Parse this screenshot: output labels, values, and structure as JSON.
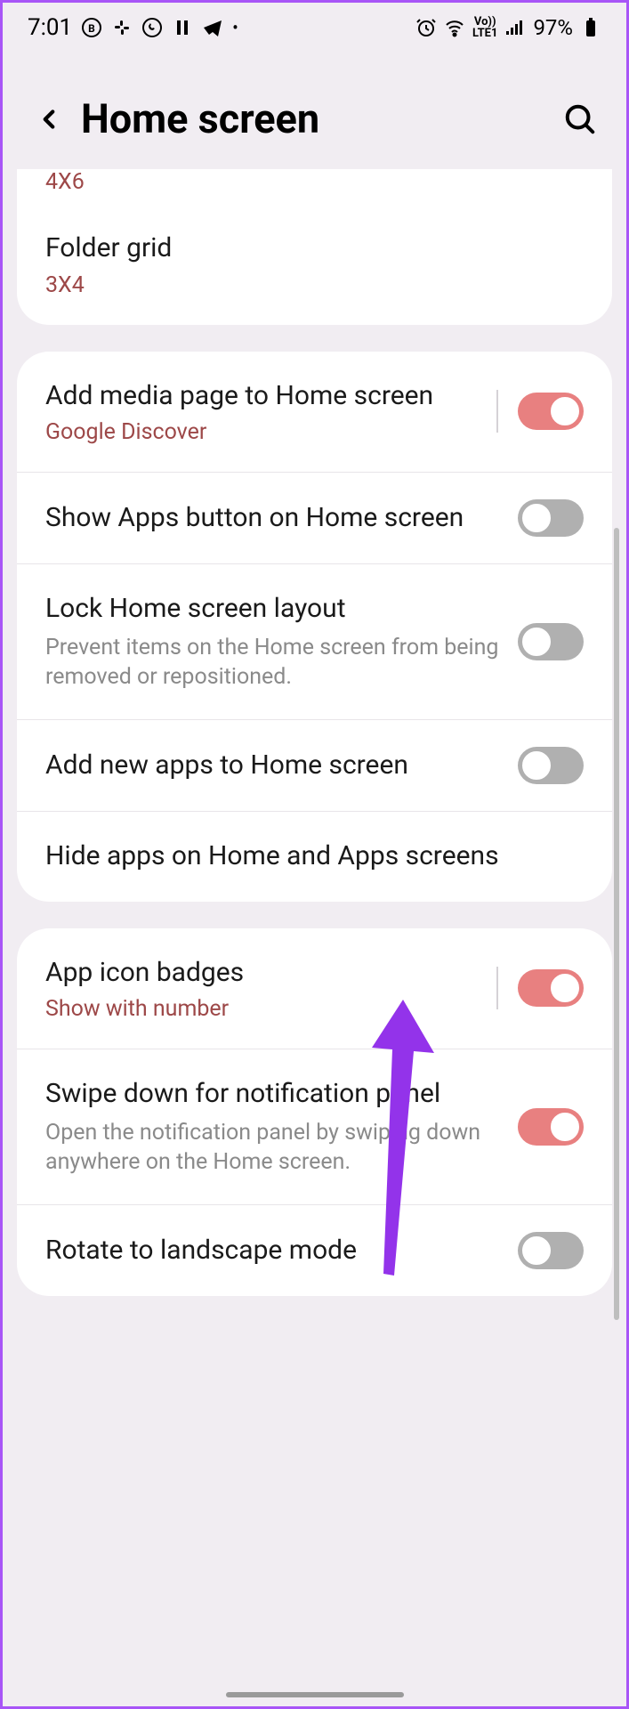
{
  "status_bar": {
    "time": "7:01",
    "battery": "97%"
  },
  "header": {
    "title": "Home screen"
  },
  "peek_value": "4X6",
  "group1": {
    "folder_grid": {
      "title": "Folder grid",
      "value": "3X4"
    }
  },
  "group2": {
    "media_page": {
      "title": "Add media page to Home screen",
      "subtitle": "Google Discover",
      "on": true
    },
    "apps_button": {
      "title": "Show Apps button on Home screen",
      "on": false
    },
    "lock_layout": {
      "title": "Lock Home screen layout",
      "desc": "Prevent items on the Home screen from being removed or repositioned.",
      "on": false
    },
    "add_new_apps": {
      "title": "Add new apps to Home screen",
      "on": false
    },
    "hide_apps": {
      "title": "Hide apps on Home and Apps screens"
    }
  },
  "group3": {
    "icon_badges": {
      "title": "App icon badges",
      "subtitle": "Show with number",
      "on": true
    },
    "swipe_down": {
      "title": "Swipe down for notification panel",
      "desc": "Open the notification panel by swiping down anywhere on the Home screen.",
      "on": true
    },
    "rotate": {
      "title": "Rotate to landscape mode",
      "on": false
    }
  }
}
